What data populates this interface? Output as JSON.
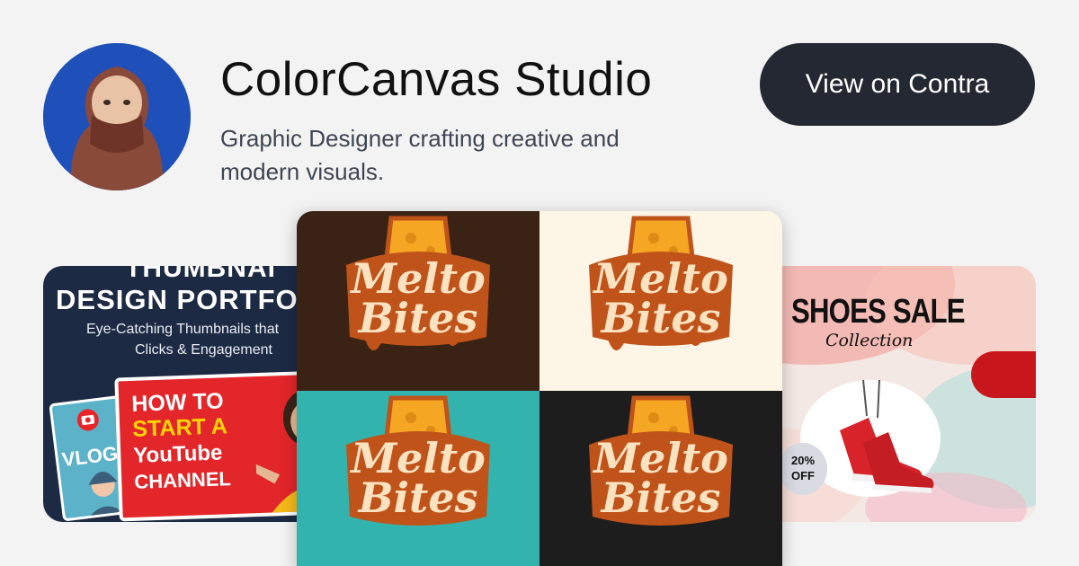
{
  "profile": {
    "name": "ColorCanvas Studio",
    "tagline": "Graphic Designer crafting creative and modern visuals.",
    "cta_label": "View on Contra"
  },
  "colors": {
    "cta_background": "#232832",
    "page_background": "#f3f3f3",
    "text_secondary": "#3e4552"
  },
  "portfolio": {
    "left": {
      "heading_line1": "THUMBNAI",
      "heading_line2": "DESIGN PORTFO",
      "subtitle_line1": "Eye-Catching Thumbnails that",
      "subtitle_line2": "Clicks & Engagement",
      "vlog_label": "VLOG",
      "yt_line1": "HOW TO",
      "yt_line2": "START A",
      "yt_line3": "YouTube",
      "yt_line4": "CHANNEL"
    },
    "center": {
      "logo_line1": "Melto",
      "logo_line2": "Bites"
    },
    "right": {
      "title": "SHOES SALE",
      "subtitle": "Collection",
      "discount_line1": "20%",
      "discount_line2": "OFF"
    }
  }
}
